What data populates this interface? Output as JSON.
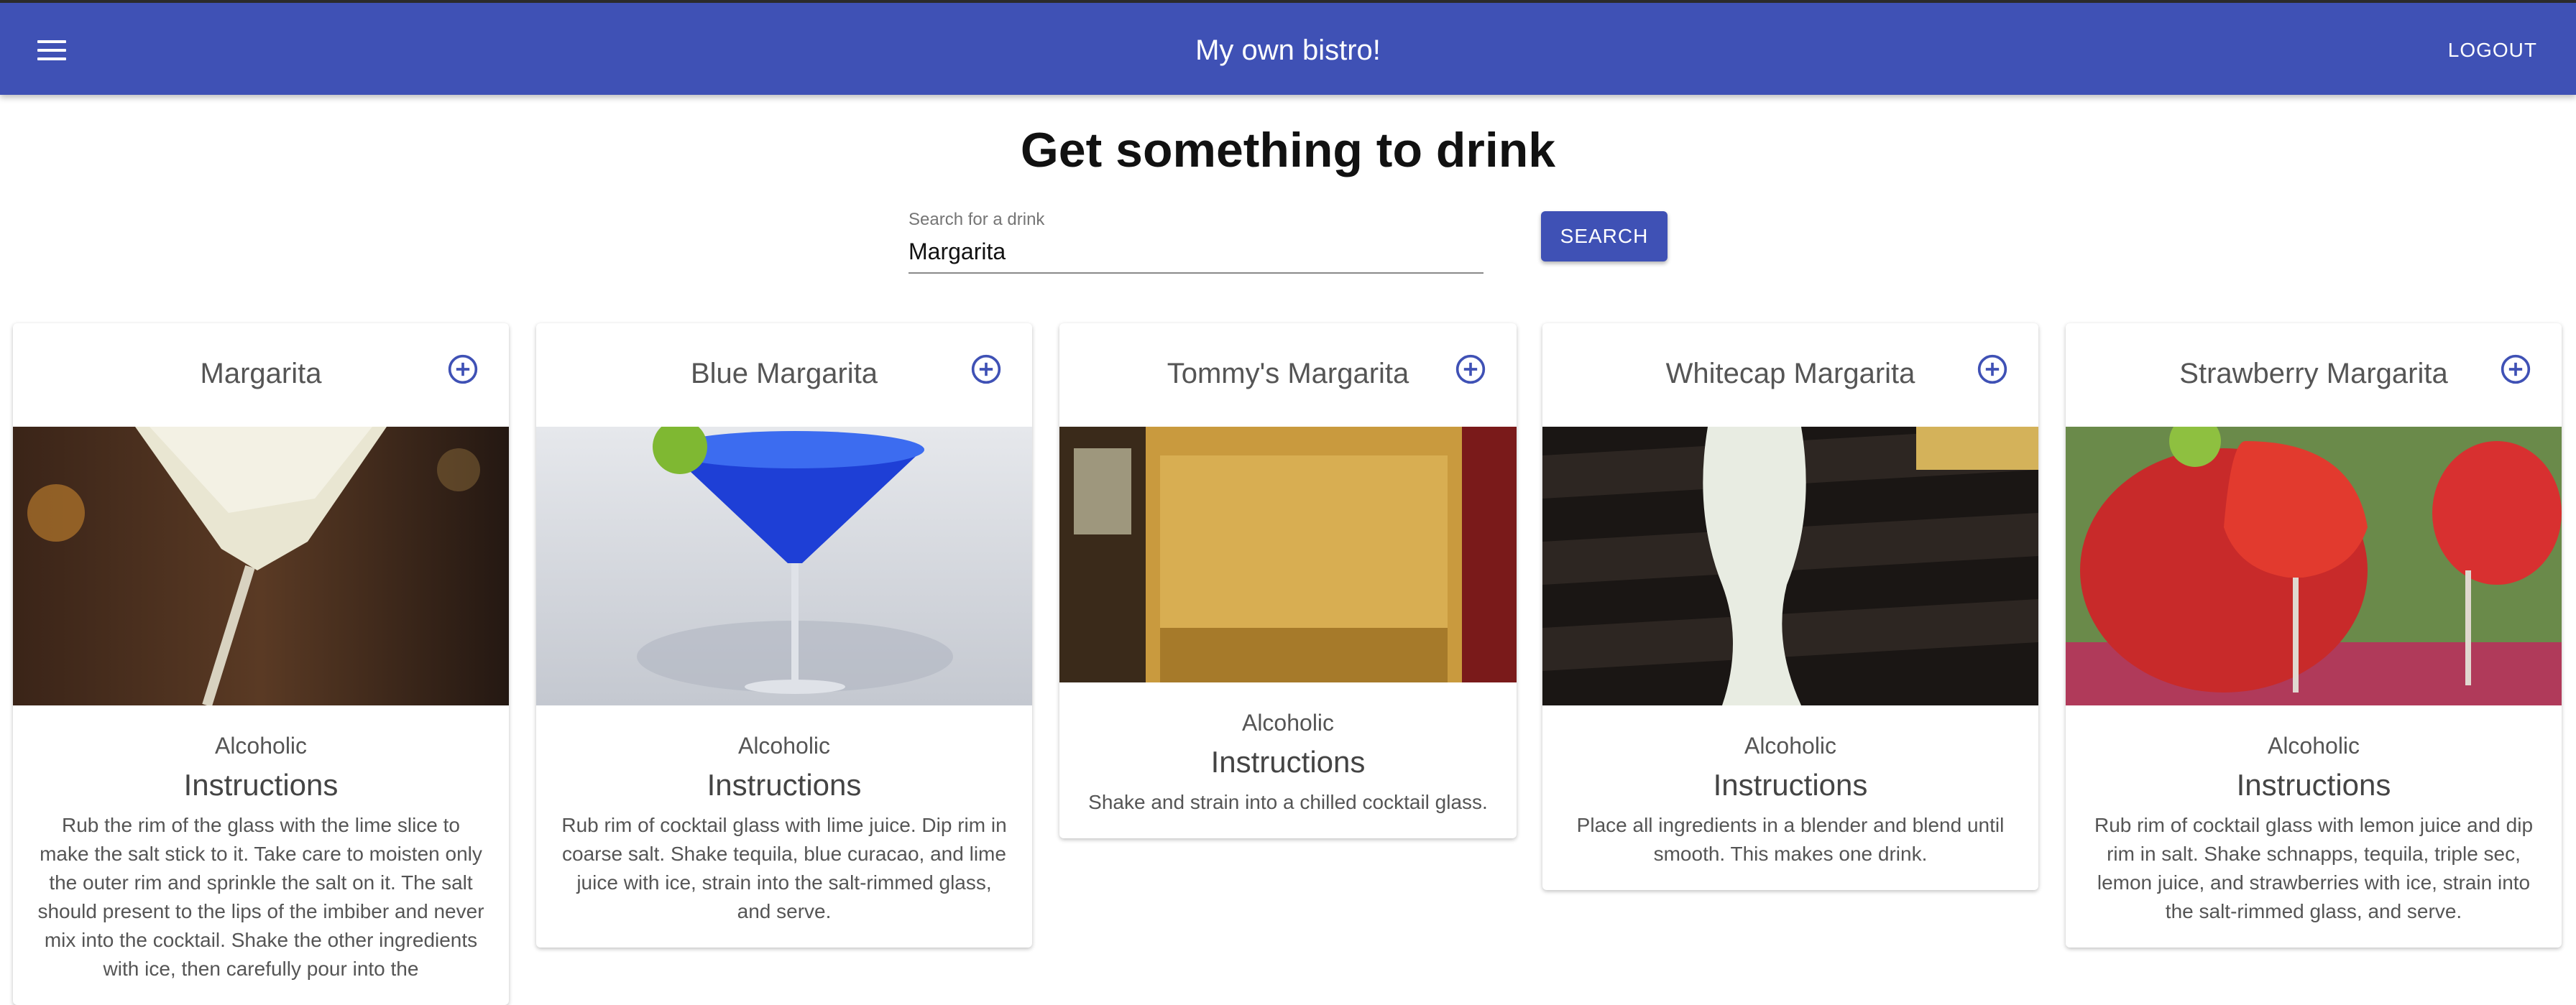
{
  "header": {
    "title": "My own bistro!",
    "logout_label": "LOGOUT",
    "menu_icon": "menu-icon",
    "color": "#3f51b5"
  },
  "page": {
    "heading": "Get something to drink"
  },
  "search": {
    "label": "Search for a drink",
    "value": "Margarita",
    "button_label": "SEARCH"
  },
  "drinks": [
    {
      "name": "Margarita",
      "category": "Alcoholic",
      "instructions_heading": "Instructions",
      "instructions": "Rub the rim of the glass with the lime slice to make the salt stick to it. Take care to moisten only the outer rim and sprinkle the salt on it. The salt should present to the lips of the imbiber and never mix into the cocktail. Shake the other ingredients with ice, then carefully pour into the"
    },
    {
      "name": "Blue Margarita",
      "category": "Alcoholic",
      "instructions_heading": "Instructions",
      "instructions": "Rub rim of cocktail glass with lime juice. Dip rim in coarse salt. Shake tequila, blue curacao, and lime juice with ice, strain into the salt-rimmed glass, and serve."
    },
    {
      "name": "Tommy's Margarita",
      "category": "Alcoholic",
      "instructions_heading": "Instructions",
      "instructions": "Shake and strain into a chilled cocktail glass."
    },
    {
      "name": "Whitecap Margarita",
      "category": "Alcoholic",
      "instructions_heading": "Instructions",
      "instructions": "Place all ingredients in a blender and blend until smooth. This makes one drink."
    },
    {
      "name": "Strawberry Margarita",
      "category": "Alcoholic",
      "instructions_heading": "Instructions",
      "instructions": "Rub rim of cocktail glass with lemon juice and dip rim in salt. Shake schnapps, tequila, triple sec, lemon juice, and strawberries with ice, strain into the salt-rimmed glass, and serve."
    }
  ],
  "icons": {
    "add": "add-circle-icon"
  }
}
